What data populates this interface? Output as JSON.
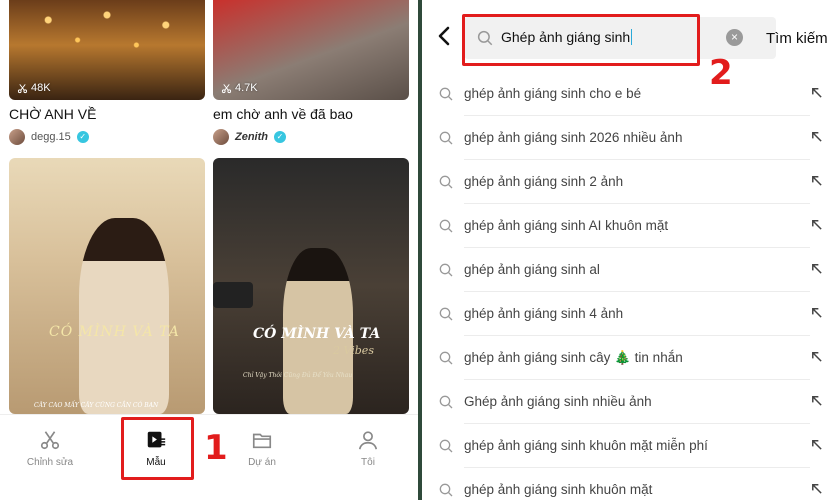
{
  "left": {
    "cards": [
      {
        "views": "48K",
        "title": "CHỜ ANH VỀ",
        "author": "degg.15"
      },
      {
        "views": "4.7K",
        "title": "em chờ anh về đã bao",
        "author": "Zenith"
      }
    ],
    "thumb_c": {
      "overlay": "CÓ MÌNH VÀ TA",
      "caption": "CÂY CAO MẤY CÂY CŨNG CẦN CÓ BẠN"
    },
    "thumb_d": {
      "overlay": "CÓ MÌNH VÀ TA",
      "script": "2 Vibes",
      "caption": "Chỉ Vậy Thôi Cũng Đủ Để Yêu Nhau"
    },
    "nav": [
      {
        "label": "Chỉnh sửa",
        "icon": "scissors-icon"
      },
      {
        "label": "Mẫu",
        "icon": "template-icon"
      },
      {
        "label": "Dự án",
        "icon": "folder-icon"
      },
      {
        "label": "Tôi",
        "icon": "person-icon"
      }
    ],
    "marker": "1"
  },
  "right": {
    "search_value": "Ghép ảnh giáng sinh",
    "search_button": "Tìm kiếm",
    "marker": "2",
    "suggestions": [
      "ghép ảnh giáng sinh cho e bé",
      "ghép ảnh giáng sinh 2026 nhiều ảnh",
      "ghép ảnh giáng sinh 2 ảnh",
      "ghép ảnh giáng sinh AI khuôn mặt",
      "ghép ảnh giáng sinh al",
      "ghép ảnh giáng sinh 4 ảnh",
      "ghép ảnh giáng sinh cây 🎄 tin nhắn",
      "Ghép ảnh giáng sinh nhiều ảnh",
      "ghép ảnh giáng sinh khuôn mặt miễn phí",
      "ghép ảnh giáng sinh khuôn mặt"
    ]
  },
  "colors": {
    "highlight": "#e21c1c",
    "search_bg": "#f1f1f1",
    "verified": "#37c6e0"
  }
}
